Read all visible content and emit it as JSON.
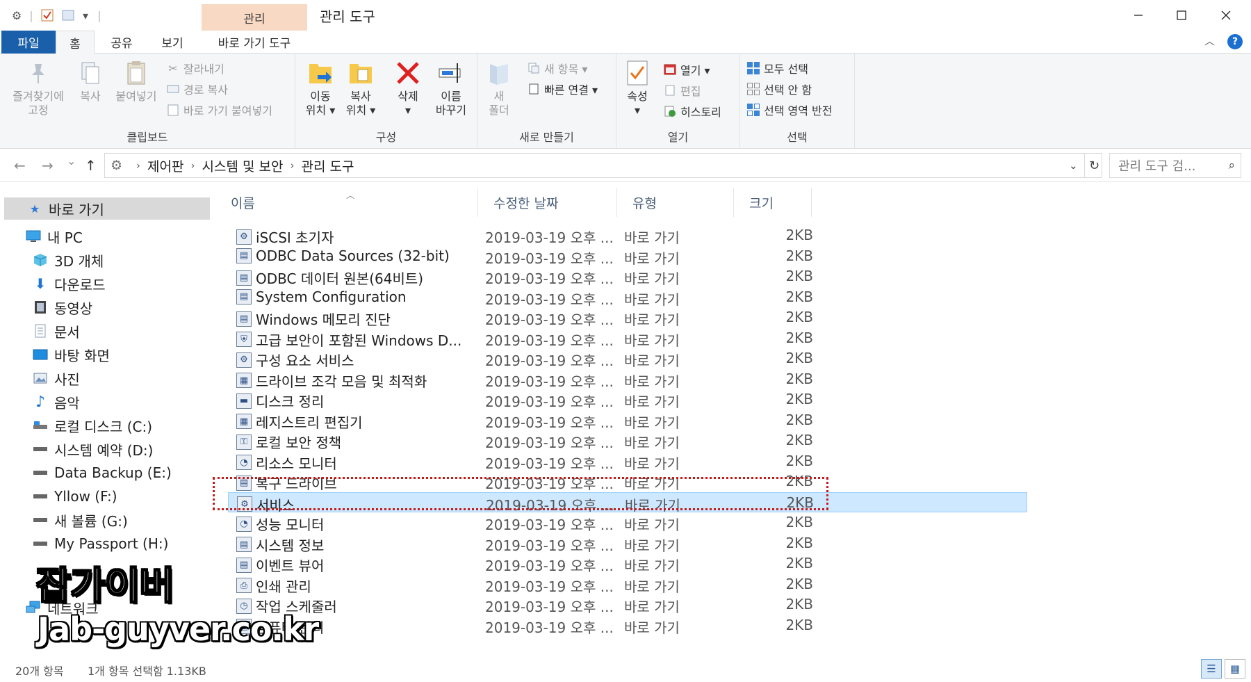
{
  "titlebar": {
    "context_tab": "관리",
    "title": "관리 도구",
    "qa_sep": "|",
    "qa_dropdown": "▾"
  },
  "tabs": {
    "file": "파일",
    "home": "홈",
    "share": "공유",
    "view": "보기",
    "shortcut_tools": "바로 가기 도구"
  },
  "ribbon": {
    "clipboard": {
      "label": "클립보드",
      "pin_line1": "즐겨찾기에",
      "pin_line2": "고정",
      "copy": "복사",
      "paste": "붙여넣기",
      "cut": "잘라내기",
      "copy_path": "경로 복사",
      "paste_shortcut": "바로 가기 붙여넣기"
    },
    "organize": {
      "label": "구성",
      "move_line1": "이동",
      "move_line2": "위치 ▾",
      "copyto_line1": "복사",
      "copyto_line2": "위치 ▾",
      "delete_line1": "삭제",
      "delete_line2": "▾",
      "rename_line1": "이름",
      "rename_line2": "바꾸기"
    },
    "new": {
      "label": "새로 만들기",
      "folder_line1": "새",
      "folder_line2": "폴더",
      "new_item": "새 항목 ▾",
      "easy_access": "빠른 연결 ▾"
    },
    "open": {
      "label": "열기",
      "props_line1": "속성",
      "props_line2": "▾",
      "open": "열기 ▾",
      "edit": "편집",
      "history": "히스토리"
    },
    "select": {
      "label": "선택",
      "select_all": "모두 선택",
      "select_none": "선택 안 함",
      "invert": "선택 영역 반전"
    }
  },
  "address": {
    "back": "←",
    "forward": "→",
    "recent": "⌄",
    "up": "↑",
    "crumbs": [
      "제어판",
      "시스템 및 보안",
      "관리 도구"
    ],
    "sep": "›",
    "search_placeholder": "관리 도구 검..."
  },
  "navpane": {
    "quick_access": "바로 가기",
    "items": [
      {
        "label": "내 PC",
        "icon": "pc-icon"
      },
      {
        "label": "3D 개체",
        "icon": "3d-objects-icon"
      },
      {
        "label": "다운로드",
        "icon": "download-icon"
      },
      {
        "label": "동영상",
        "icon": "video-icon"
      },
      {
        "label": "문서",
        "icon": "documents-icon"
      },
      {
        "label": "바탕 화면",
        "icon": "desktop-icon"
      },
      {
        "label": "사진",
        "icon": "pictures-icon"
      },
      {
        "label": "음악",
        "icon": "music-icon"
      },
      {
        "label": "로컬 디스크 (C:)",
        "icon": "drive-icon"
      },
      {
        "label": "시스템 예약 (D:)",
        "icon": "drive-icon"
      },
      {
        "label": "Data Backup (E:)",
        "icon": "drive-icon"
      },
      {
        "label": "Yllow (F:)",
        "icon": "drive-icon"
      },
      {
        "label": "새 볼륨 (G:)",
        "icon": "drive-icon"
      },
      {
        "label": "My Passport (H:)",
        "icon": "drive-icon"
      },
      {
        "label": "네트워크",
        "icon": "network-icon"
      }
    ]
  },
  "filelist": {
    "columns": {
      "name": "이름",
      "date": "수정한 날짜",
      "type": "유형",
      "size": "크기"
    },
    "rows": [
      {
        "name": "iSCSI 초기자",
        "date": "2019-03-19 오후 ...",
        "type": "바로 가기",
        "size": "2KB"
      },
      {
        "name": "ODBC Data Sources (32-bit)",
        "date": "2019-03-19 오후 ...",
        "type": "바로 가기",
        "size": "2KB"
      },
      {
        "name": "ODBC 데이터 원본(64비트)",
        "date": "2019-03-19 오후 ...",
        "type": "바로 가기",
        "size": "2KB"
      },
      {
        "name": "System Configuration",
        "date": "2019-03-19 오후 ...",
        "type": "바로 가기",
        "size": "2KB"
      },
      {
        "name": "Windows 메모리 진단",
        "date": "2019-03-19 오후 ...",
        "type": "바로 가기",
        "size": "2KB"
      },
      {
        "name": "고급 보안이 포함된 Windows D...",
        "date": "2019-03-19 오후 ...",
        "type": "바로 가기",
        "size": "2KB"
      },
      {
        "name": "구성 요소 서비스",
        "date": "2019-03-19 오후 ...",
        "type": "바로 가기",
        "size": "2KB"
      },
      {
        "name": "드라이브 조각 모음 및 최적화",
        "date": "2019-03-19 오후 ...",
        "type": "바로 가기",
        "size": "2KB"
      },
      {
        "name": "디스크 정리",
        "date": "2019-03-19 오후 ...",
        "type": "바로 가기",
        "size": "2KB"
      },
      {
        "name": "레지스트리 편집기",
        "date": "2019-03-19 오후 ...",
        "type": "바로 가기",
        "size": "2KB"
      },
      {
        "name": "로컬 보안 정책",
        "date": "2019-03-19 오후 ...",
        "type": "바로 가기",
        "size": "2KB"
      },
      {
        "name": "리소스 모니터",
        "date": "2019-03-19 오후 ...",
        "type": "바로 가기",
        "size": "2KB"
      },
      {
        "name": "복구 드라이브",
        "date": "2019-03-19 오후 ...",
        "type": "바로 가기",
        "size": "2KB"
      },
      {
        "name": "서비스",
        "date": "2019-03-19 오후 ...",
        "type": "바로 가기",
        "size": "2KB"
      },
      {
        "name": "성능 모니터",
        "date": "2019-03-19 오후 ...",
        "type": "바로 가기",
        "size": "2KB"
      },
      {
        "name": "시스템 정보",
        "date": "2019-03-19 오후 ...",
        "type": "바로 가기",
        "size": "2KB"
      },
      {
        "name": "이벤트 뷰어",
        "date": "2019-03-19 오후 ...",
        "type": "바로 가기",
        "size": "2KB"
      },
      {
        "name": "인쇄 관리",
        "date": "2019-03-19 오후 ...",
        "type": "바로 가기",
        "size": "2KB"
      },
      {
        "name": "작업 스케줄러",
        "date": "2019-03-19 오후 ...",
        "type": "바로 가기",
        "size": "2KB"
      },
      {
        "name": "컴퓨터 관리",
        "date": "2019-03-19 오후 ...",
        "type": "바로 가기",
        "size": "2KB"
      }
    ],
    "selected_index": 13
  },
  "status": {
    "count": "20개 항목",
    "selection": "1개 항목 선택함 1.13KB"
  },
  "watermark": {
    "line1": "잡가이버",
    "line2": "Jab-guyver.co.kr"
  },
  "colors": {
    "accent": "#1a5fa9",
    "context_tab": "#f8d9c4",
    "selection": "#cde8ff",
    "highlight_box": "#c51a1a"
  }
}
